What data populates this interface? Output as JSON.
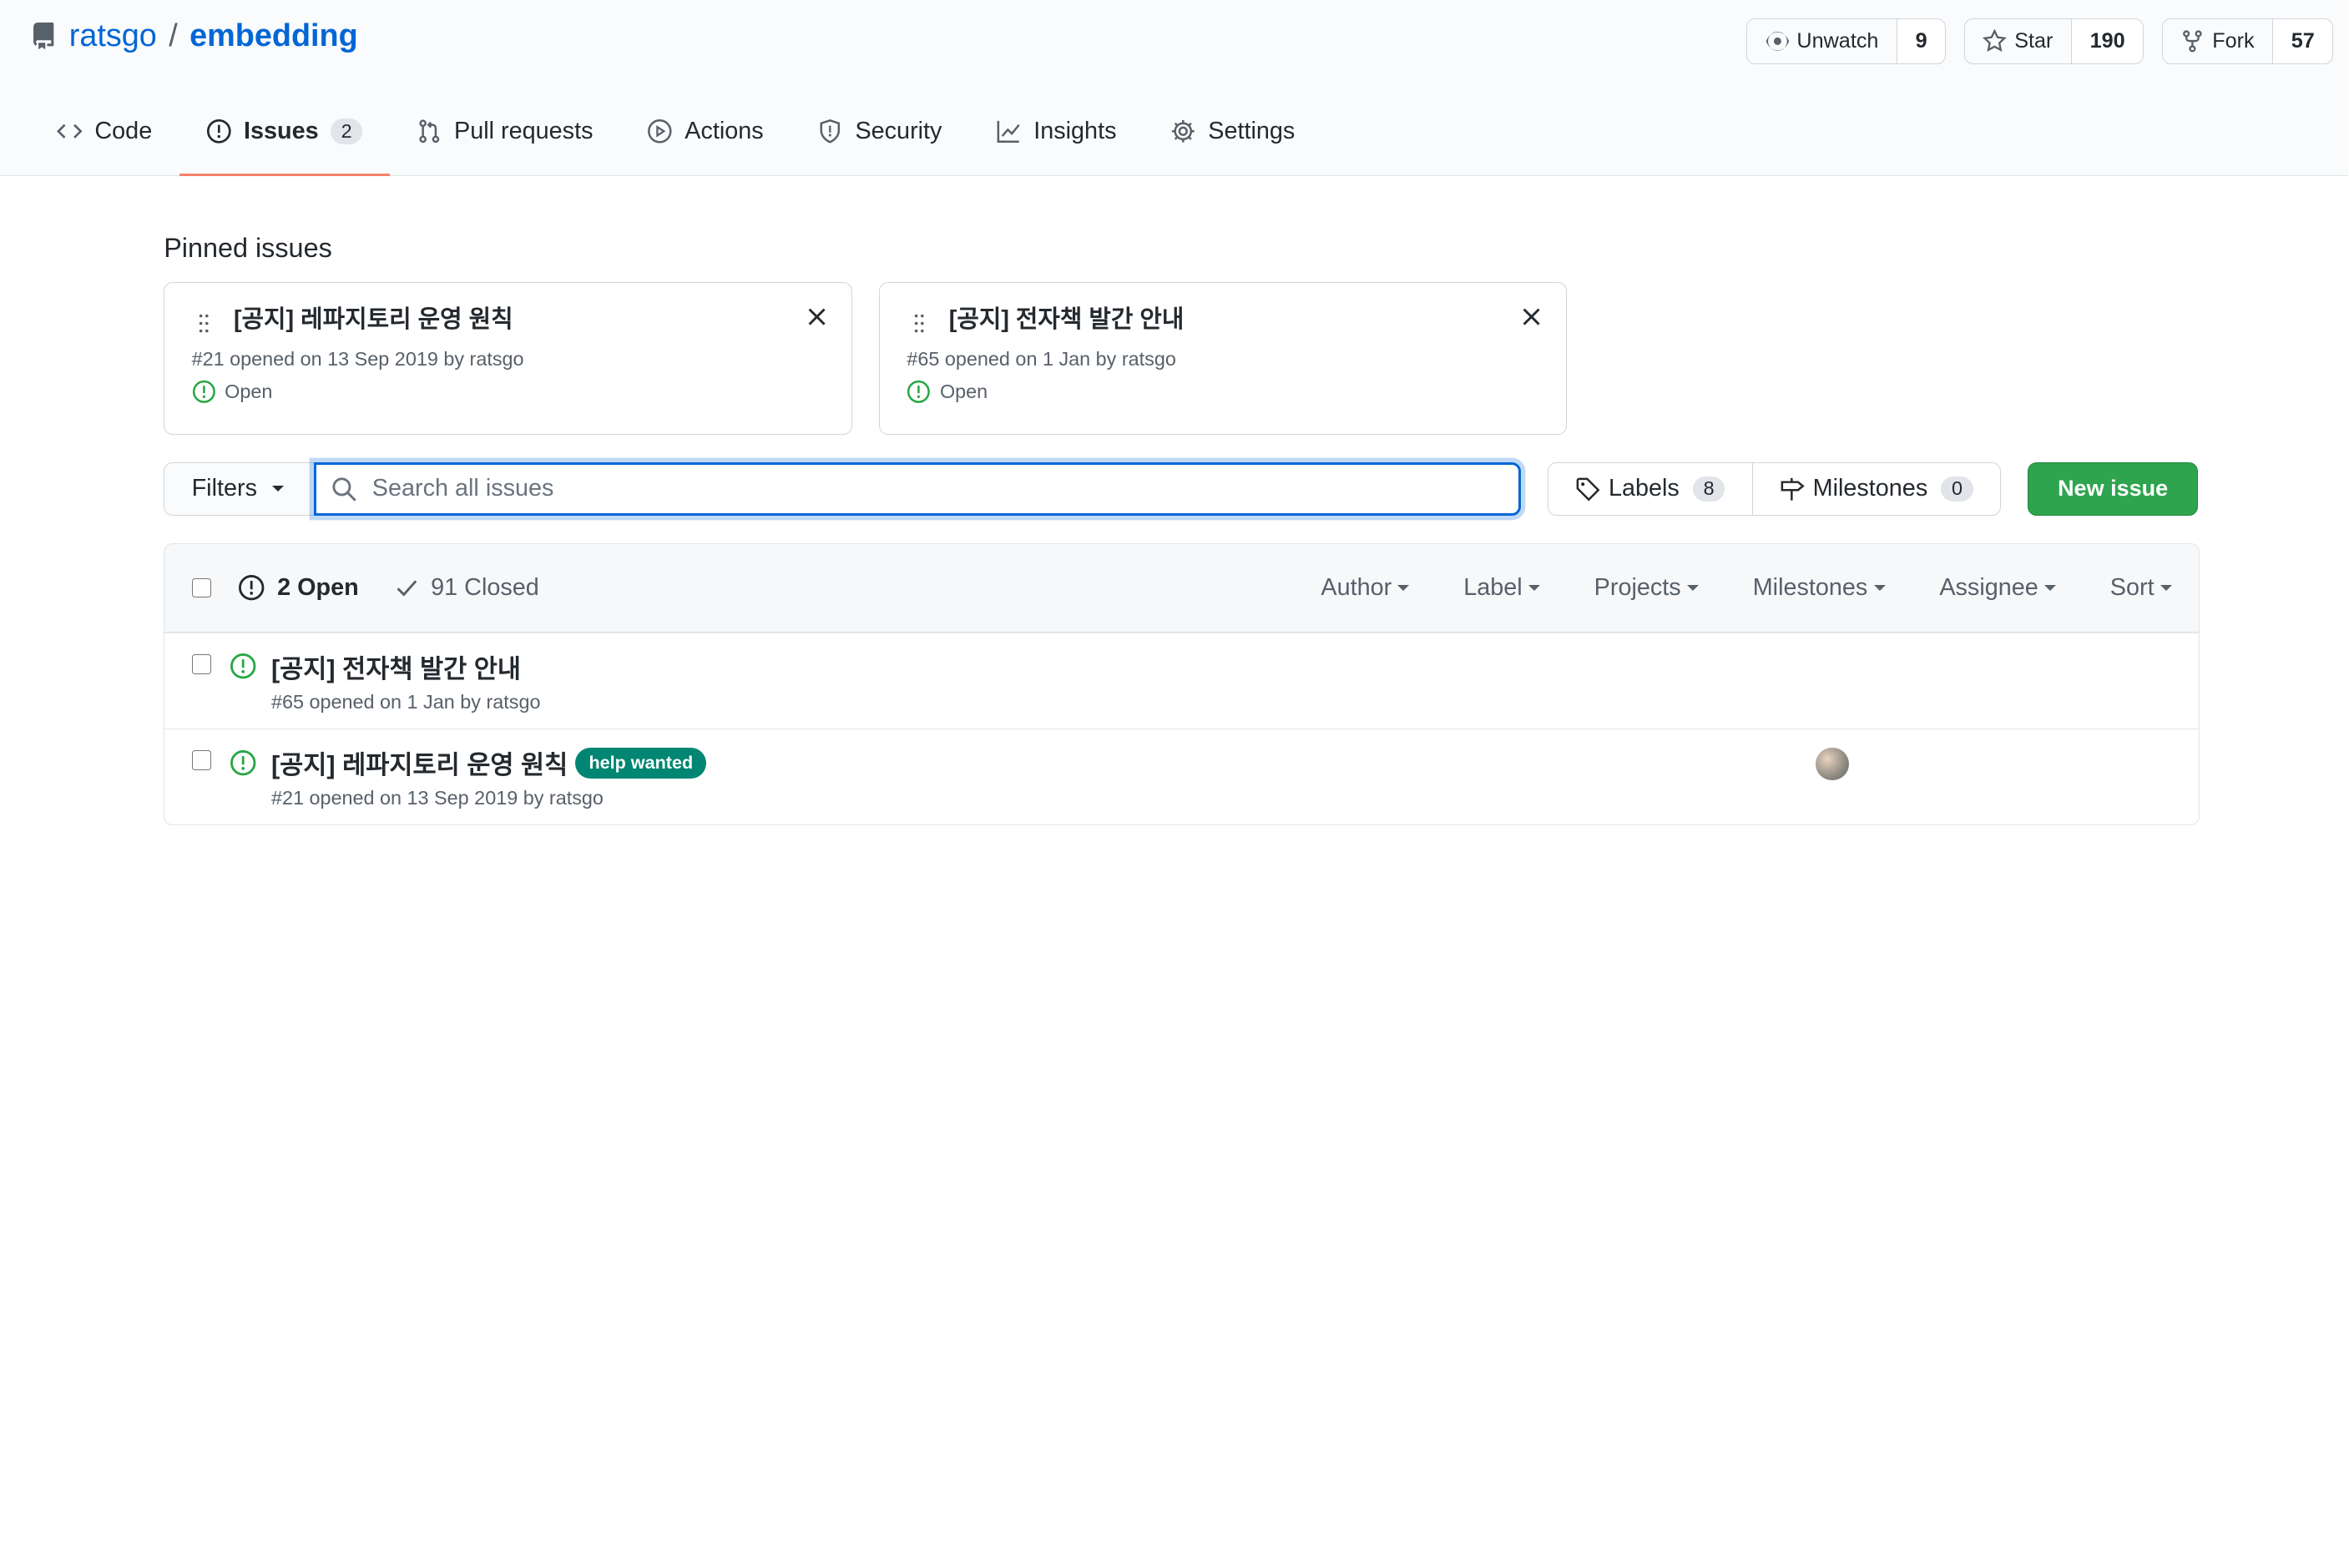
{
  "repo": {
    "owner": "ratsgo",
    "separator": "/",
    "name": "embedding"
  },
  "actions": {
    "watch": {
      "label": "Unwatch",
      "count": "9"
    },
    "star": {
      "label": "Star",
      "count": "190"
    },
    "fork": {
      "label": "Fork",
      "count": "57"
    }
  },
  "tabs": [
    {
      "label": "Code",
      "icon": "code-icon"
    },
    {
      "label": "Issues",
      "icon": "issue-opened-icon",
      "count": "2",
      "selected": true
    },
    {
      "label": "Pull requests",
      "icon": "git-pull-request-icon"
    },
    {
      "label": "Actions",
      "icon": "play-icon"
    },
    {
      "label": "Security",
      "icon": "shield-icon"
    },
    {
      "label": "Insights",
      "icon": "graph-icon"
    },
    {
      "label": "Settings",
      "icon": "gear-icon"
    }
  ],
  "pinned": {
    "heading": "Pinned issues",
    "items": [
      {
        "title": "[공지] 레파지토리 운영 원칙",
        "meta": "#21 opened on 13 Sep 2019 by ratsgo",
        "status": "Open"
      },
      {
        "title": "[공지] 전자책 발간 안내",
        "meta": "#65 opened on 1 Jan by ratsgo",
        "status": "Open"
      }
    ]
  },
  "toolbar": {
    "filters_label": "Filters",
    "search_placeholder": "Search all issues",
    "labels": {
      "label": "Labels",
      "count": "8"
    },
    "milestones": {
      "label": "Milestones",
      "count": "0"
    },
    "new_issue_label": "New issue"
  },
  "list_header": {
    "open_label": "2 Open",
    "closed_label": "91 Closed",
    "sorts": [
      "Author",
      "Label",
      "Projects",
      "Milestones",
      "Assignee",
      "Sort"
    ]
  },
  "issues": [
    {
      "title": "[공지] 전자책 발간 안내",
      "meta": "#65 opened on 1 Jan by ratsgo",
      "labels": []
    },
    {
      "title": "[공지] 레파지토리 운영 원칙",
      "meta": "#21 opened on 13 Sep 2019 by ratsgo",
      "labels": [
        {
          "name": "help wanted",
          "color": "#008672"
        }
      ],
      "has_assignee_avatar": true
    }
  ],
  "colors": {
    "accent": "#0366d6",
    "open_green": "#28a745",
    "tab_underline": "#f9826c",
    "new_issue_bg": "#2ea44f"
  }
}
